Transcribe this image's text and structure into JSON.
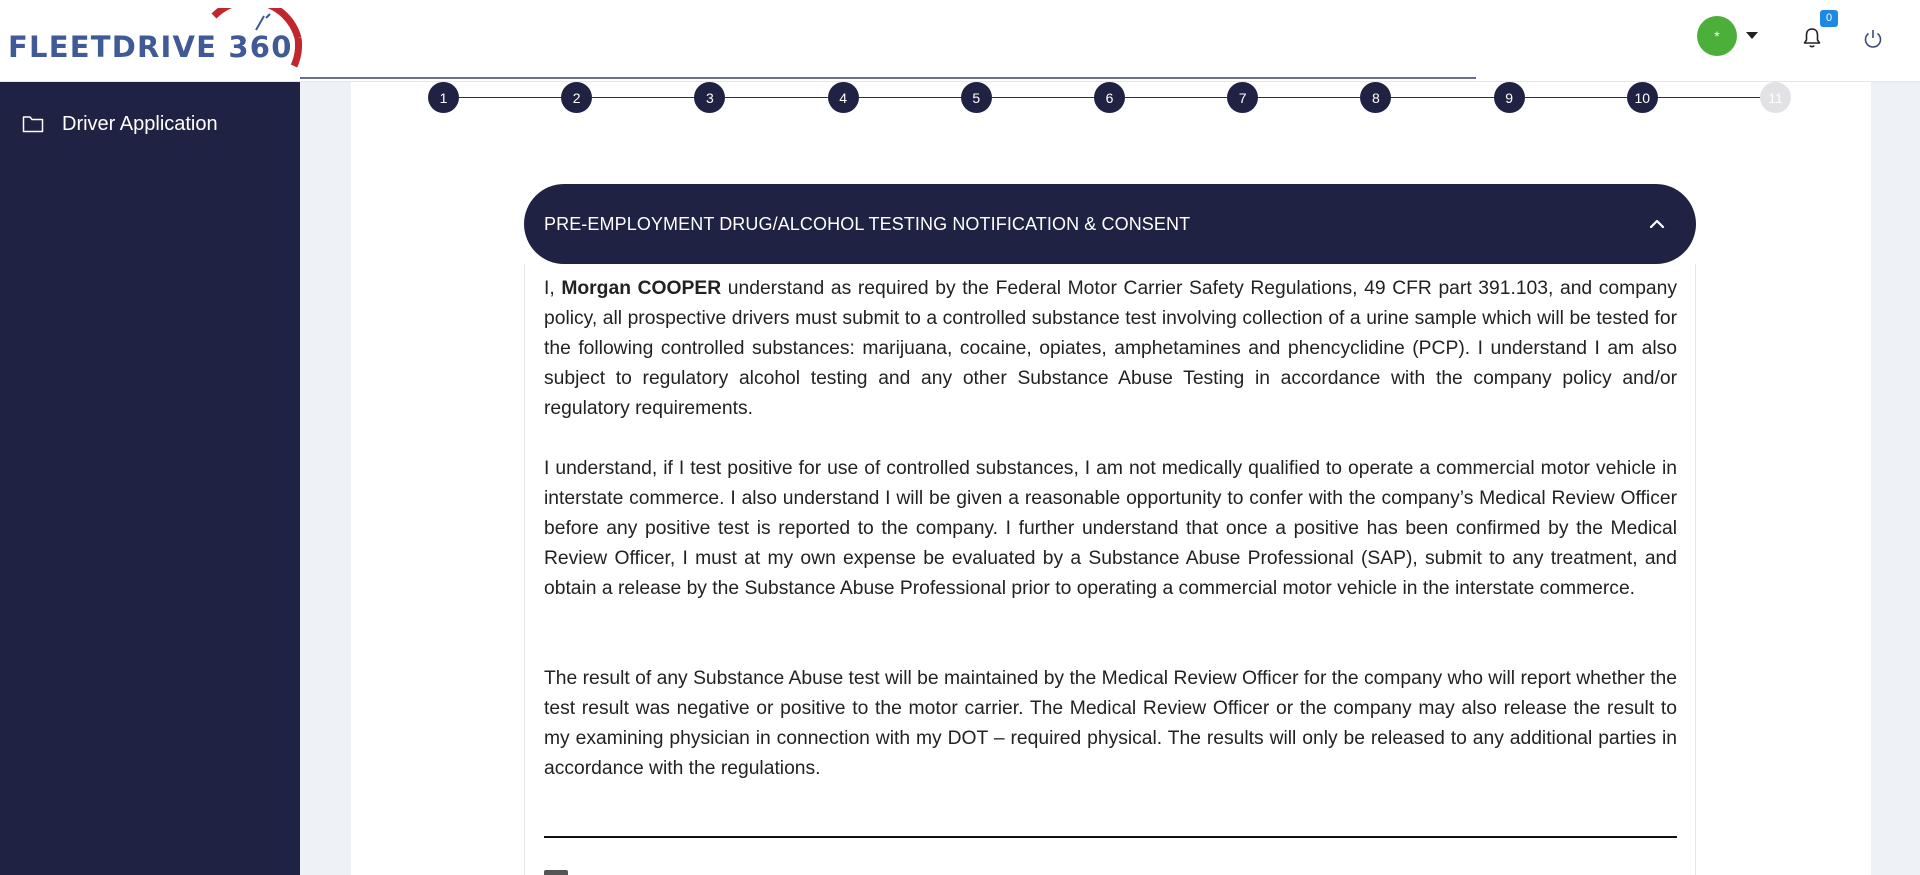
{
  "brand": {
    "logo_text": "FLEETDRIVE 360",
    "colors": {
      "navy": "#1f2242",
      "logo_blue": "#3f5a96",
      "logo_red": "#c0262d",
      "avatar_green": "#4caf3a",
      "badge_blue": "#1e88e5"
    }
  },
  "header": {
    "avatar_initial": "*",
    "notification_count": "0",
    "icons": [
      "chevron-down-icon",
      "bell-icon",
      "power-icon"
    ]
  },
  "sidebar": {
    "items": [
      {
        "label": "Driver Application",
        "icon": "folder-icon"
      }
    ]
  },
  "stepper": {
    "steps": [
      "1",
      "2",
      "3",
      "4",
      "5",
      "6",
      "7",
      "8",
      "9",
      "10",
      "11"
    ],
    "current_step": 10
  },
  "section": {
    "title": "PRE-EMPLOYMENT DRUG/ALCOHOL TESTING NOTIFICATION & CONSENT",
    "applicant_name": "Morgan COOPER",
    "p1_prefix": "I, ",
    "p1_rest": " understand as required by the Federal Motor Carrier Safety Regulations, 49 CFR part 391.103, and company policy, all prospective drivers must submit to a controlled substance test involving collection of a urine sample which will be tested for the following controlled substances: marijuana, cocaine, opiates, amphetamines and phencyclidine (PCP). I understand I am also subject to regulatory alcohol testing and any other Substance Abuse Testing in accordance with the company policy and/or regulatory requirements.",
    "p2": "I understand, if I test positive for use of controlled substances, I am not medically qualified to operate a commercial motor vehicle in interstate commerce. I also understand I will be given a reasonable opportunity to confer with the company’s Medical Review Officer before any positive test is reported to the company. I further understand that once a positive has been confirmed by the Medical Review Officer, I must at my own expense be evaluated by a Substance Abuse Professional (SAP), submit to any treatment, and obtain a release by the Substance Abuse Professional prior to operating a commercial motor vehicle in the interstate commerce.",
    "p3": "The result of any Substance Abuse test will be maintained by the Medical Review Officer for the company who will report whether the test result was negative or positive to the motor carrier. The Medical Review Officer or the company may also release the result to my examining physician in connection with my DOT – required physical. The results will only be released to any additional parties in accordance with the regulations."
  }
}
